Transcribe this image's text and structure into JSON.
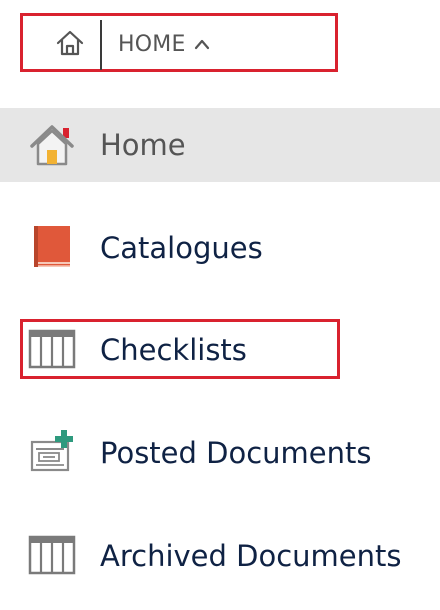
{
  "breadcrumb": {
    "home_icon": "home-outline-icon",
    "current": "HOME",
    "chevron": "chevron-up-icon"
  },
  "nav": {
    "items": [
      {
        "label": "Home",
        "icon": "home-icon",
        "active": true
      },
      {
        "label": "Catalogues",
        "icon": "book-icon",
        "active": false
      },
      {
        "label": "Checklists",
        "icon": "table-icon",
        "active": false
      },
      {
        "label": "Posted Documents",
        "icon": "posted-document-icon",
        "active": false
      },
      {
        "label": "Archived Documents",
        "icon": "table-icon",
        "active": false
      }
    ]
  },
  "colors": {
    "highlight": "#d9222f",
    "active_background": "#e6e6e6",
    "label_text": "#0f2244",
    "book_red": "#e0583a",
    "plus_green": "#2e9a7e"
  }
}
